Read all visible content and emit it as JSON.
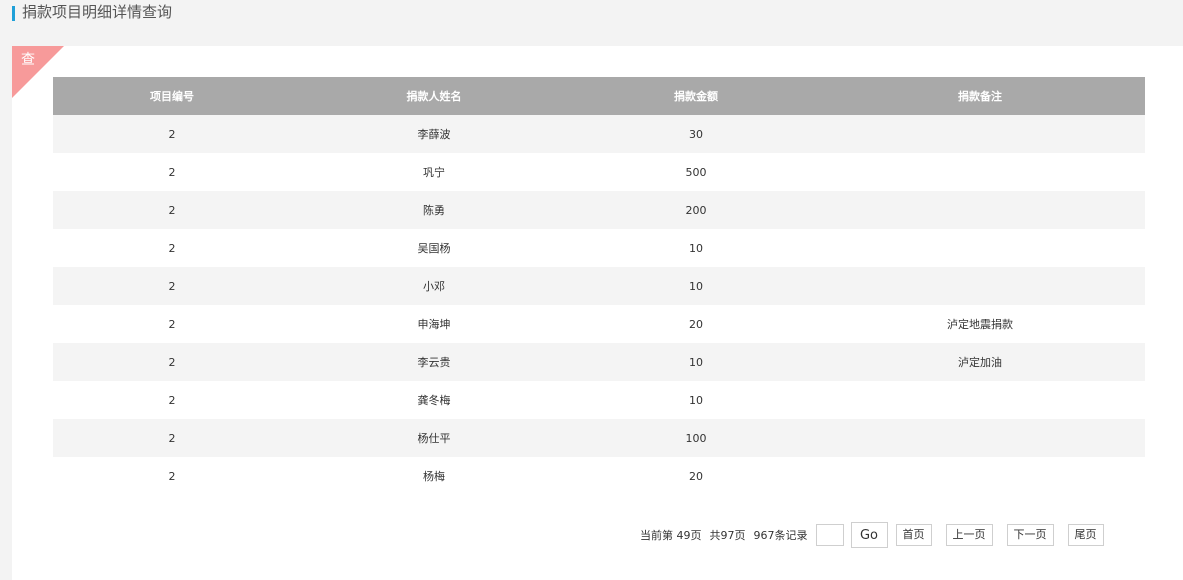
{
  "header": {
    "title": "捐款项目明细详情查询"
  },
  "corner": {
    "label": "查"
  },
  "table": {
    "columns": [
      "项目编号",
      "捐款人姓名",
      "捐款金额",
      "捐款备注"
    ],
    "rows": [
      [
        "2",
        "李薛波",
        "30",
        ""
      ],
      [
        "2",
        "巩宁",
        "500",
        ""
      ],
      [
        "2",
        "陈勇",
        "200",
        ""
      ],
      [
        "2",
        "吴国杨",
        "10",
        ""
      ],
      [
        "2",
        "小邓",
        "10",
        ""
      ],
      [
        "2",
        "申海坤",
        "20",
        "泸定地震捐款"
      ],
      [
        "2",
        "李云贵",
        "10",
        "泸定加油"
      ],
      [
        "2",
        "龚冬梅",
        "10",
        ""
      ],
      [
        "2",
        "杨仕平",
        "100",
        ""
      ],
      [
        "2",
        "杨梅",
        "20",
        ""
      ]
    ]
  },
  "pager": {
    "current": "当前第  49页",
    "total_pages": "共97页",
    "total_records": "967条记录",
    "input_value": "",
    "go_label": "Go",
    "first_label": "首页",
    "prev_label": "上一页",
    "next_label": "下一页",
    "last_label": "尾页"
  }
}
